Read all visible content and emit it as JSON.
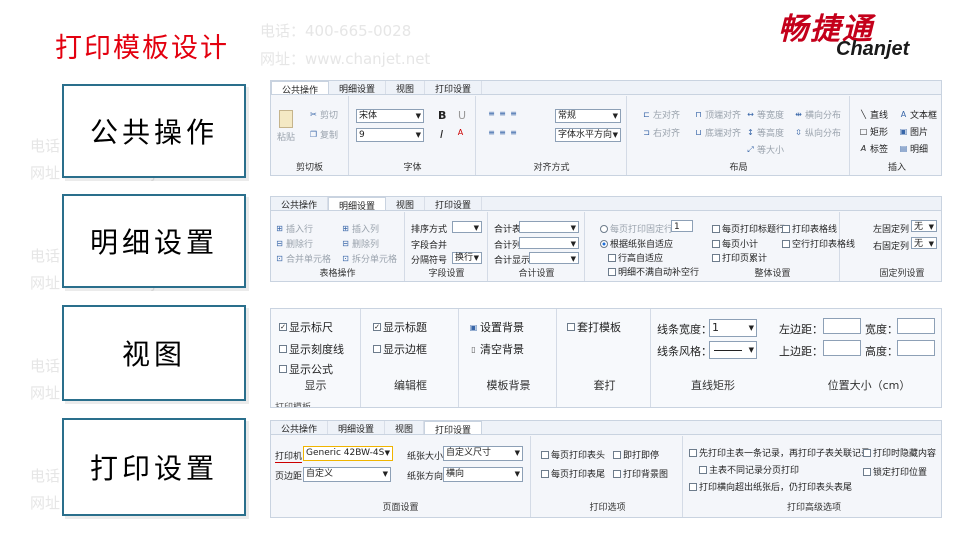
{
  "slide": {
    "title": "打印模板设计",
    "watermark_phone": "电话：400-665-0028",
    "watermark_url": "网址：www.chanjet.net"
  },
  "logo": {
    "cn": "畅捷通",
    "en": "Chanjet"
  },
  "labels": [
    "公共操作",
    "明细设置",
    "视图",
    "打印设置"
  ],
  "panel1": {
    "tabs": [
      "公共操作",
      "明细设置",
      "视图",
      "打印设置"
    ],
    "paste": "粘贴",
    "cut": "剪切",
    "copy": "复制",
    "clipboard": "剪切板",
    "font_name": "宋体",
    "font_size": "9",
    "bold": "B",
    "italic": "I",
    "underline": "U",
    "font": "字体",
    "align_mode": "常规",
    "h_align": "字体水平方向",
    "align_group": "对齐方式",
    "left_align": "左对齐",
    "top_align": "顶端对齐",
    "equal_width": "等宽度",
    "h_distribute": "横向分布",
    "right_align": "右对齐",
    "bottom_align": "底端对齐",
    "equal_height": "等高度",
    "v_distribute": "纵向分布",
    "equal_size": "等大小",
    "layout": "布局",
    "line": "直线",
    "textbox": "文本框",
    "rect": "矩形",
    "image": "图片",
    "label": "标签",
    "detail": "明细",
    "insert": "插入"
  },
  "panel2": {
    "tabs": [
      "公共操作",
      "明细设置",
      "视图",
      "打印设置"
    ],
    "insert_row": "插入行",
    "insert_col": "插入列",
    "delete_row": "删除行",
    "delete_col": "删除列",
    "merge_cells": "合并单元格",
    "split_cells": "拆分单元格",
    "table_ops": "表格操作",
    "sort": "排序方式",
    "field_merge": "字段合并",
    "sep": "分隔符号",
    "sep_val": "换行",
    "field_settings": "字段设置",
    "total_table": "合计表",
    "total_col": "合计列",
    "total_show": "合计显示",
    "total_settings": "合计设置",
    "fixed_rows": "每页打印固定行",
    "fixed_rows_val": "1",
    "fit_paper": "根据纸张自适应",
    "row_fit": "行高自适应",
    "no_fill": "明细不满自动补空行",
    "title_row": "每页打印标题行",
    "page_subtotal": "每页小计",
    "page_total": "打印页累计",
    "grid_lines": "打印表格线",
    "blank_grid": "空行打印表格线",
    "overall": "整体设置",
    "left_fixed": "左固定列",
    "right_fixed": "右固定列",
    "none": "无",
    "fixed_col_settings": "固定列设置"
  },
  "panel3": {
    "show_ruler": "显示标尺",
    "show_scale": "显示刻度线",
    "show_formula": "显示公式",
    "display": "显示",
    "show_title": "显示标题",
    "show_border": "显示边框",
    "edit_frame": "编辑框",
    "set_bg": "设置背景",
    "clear_bg": "清空背景",
    "tpl_bg": "模板背景",
    "overlay": "套打模板",
    "overlay_group": "套打",
    "line_width": "线条宽度：",
    "line_width_val": "1",
    "line_style": "线条风格：",
    "line_rect": "直线矩形",
    "left_margin": "左边距：",
    "top_margin": "上边距：",
    "width": "宽度：",
    "height": "高度：",
    "pos_size": "位置大小（cm）",
    "cut_tab": "打印模板"
  },
  "panel4": {
    "tabs": [
      "公共操作",
      "明细设置",
      "视图",
      "打印设置"
    ],
    "printer": "打印机",
    "printer_val": "Generic 42BW-4S",
    "margin": "页边距",
    "margin_val": "自定义",
    "paper_size": "纸张大小",
    "paper_size_val": "自定义尺寸",
    "paper_dir": "纸张方向",
    "paper_dir_val": "横向",
    "page_setup": "页面设置",
    "header_each": "每页打印表头",
    "footer_each": "每页打印表尾",
    "print_pause": "即打即停",
    "print_bg": "打印背景图",
    "print_options": "打印选项",
    "adv1": "先打印主表一条记录，再打印子表关联记录",
    "adv2": "主表不同记录分页打印",
    "adv3": "打印横向超出纸张后，仍打印表头表尾",
    "hide_empty": "打印时隐藏内容",
    "lock_pos": "锁定打印位置",
    "adv_options": "打印高级选项"
  }
}
